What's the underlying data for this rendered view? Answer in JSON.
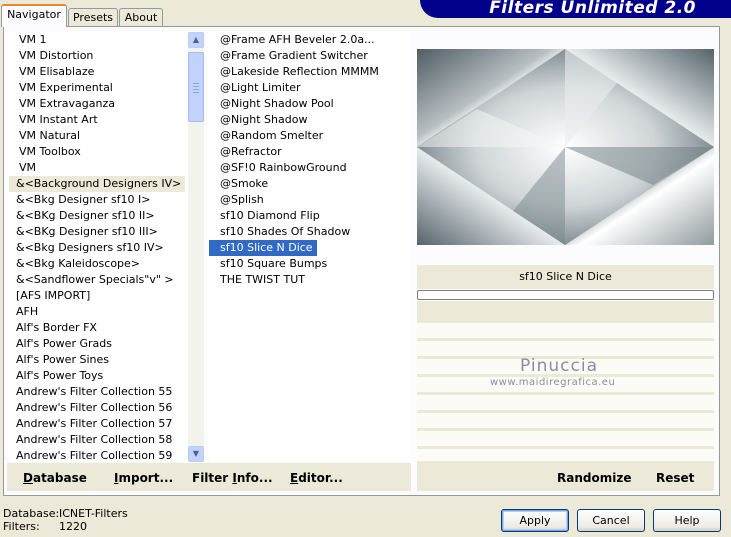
{
  "window": {
    "banner_title": "Filters Unlimited 2.0"
  },
  "tabs": [
    {
      "label": "Navigator",
      "active": true
    },
    {
      "label": "Presets",
      "active": false
    },
    {
      "label": "About",
      "active": false
    }
  ],
  "categories": {
    "items": [
      "VM 1",
      "VM Distortion",
      "VM Elisablaze",
      "VM Experimental",
      "VM Extravaganza",
      "VM Instant Art",
      "VM Natural",
      "VM Toolbox",
      "VM",
      "&<Background Designers IV>",
      "&<Bkg Designer sf10 I>",
      "&<BKg Designer sf10 II>",
      "&<BKg Designer sf10 III>",
      "&<Bkg Designers sf10 IV>",
      "&<Bkg Kaleidoscope>",
      "&<Sandflower Specials\"v\" >",
      "[AFS IMPORT]",
      "AFH",
      "Alf's Border FX",
      "Alf's Power Grads",
      "Alf's Power Sines",
      "Alf's Power Toys",
      "Andrew's Filter Collection 55",
      "Andrew's Filter Collection 56",
      "Andrew's Filter Collection 57",
      "Andrew's Filter Collection 58",
      "Andrew's Filter Collection 59"
    ],
    "highlighted_index": 9
  },
  "filters": {
    "items": [
      "@Frame AFH Beveler 2.0a...",
      "@Frame Gradient Switcher",
      "@Lakeside Reflection MMMM",
      "@Light Limiter",
      "@Night Shadow Pool",
      "@Night Shadow",
      "@Random Smelter",
      "@Refractor",
      "@SF!0 RainbowGround",
      "@Smoke",
      "@Splish",
      "sf10 Diamond Flip",
      "sf10 Shades Of Shadow",
      "sf10 Slice N Dice",
      "sf10 Square Bumps",
      "THE TWIST TUT"
    ],
    "selected_index": 13
  },
  "preview": {
    "filter_name": "sf10 Slice N Dice"
  },
  "watermark": {
    "name": "Pinuccia",
    "url": "www.maidiregrafica.eu"
  },
  "toolbar": {
    "database": {
      "accel": "D",
      "rest": "atabase"
    },
    "import": {
      "accel": "I",
      "rest": "mport..."
    },
    "filter_info": {
      "pre": "Filter ",
      "accel": "I",
      "rest": "nfo..."
    },
    "editor": {
      "accel": "E",
      "rest": "ditor..."
    },
    "randomize": "Randomize",
    "reset": "Reset"
  },
  "status": {
    "database_label": "Database:",
    "database_value": "ICNET-Filters",
    "filters_label": "Filters:",
    "filters_value": "1220"
  },
  "buttons": {
    "apply": "Apply",
    "cancel": "Cancel",
    "help": "Help"
  },
  "colors": {
    "banner": "#00008a",
    "selection": "#316ac5",
    "tab_accent": "#e68b2c"
  }
}
